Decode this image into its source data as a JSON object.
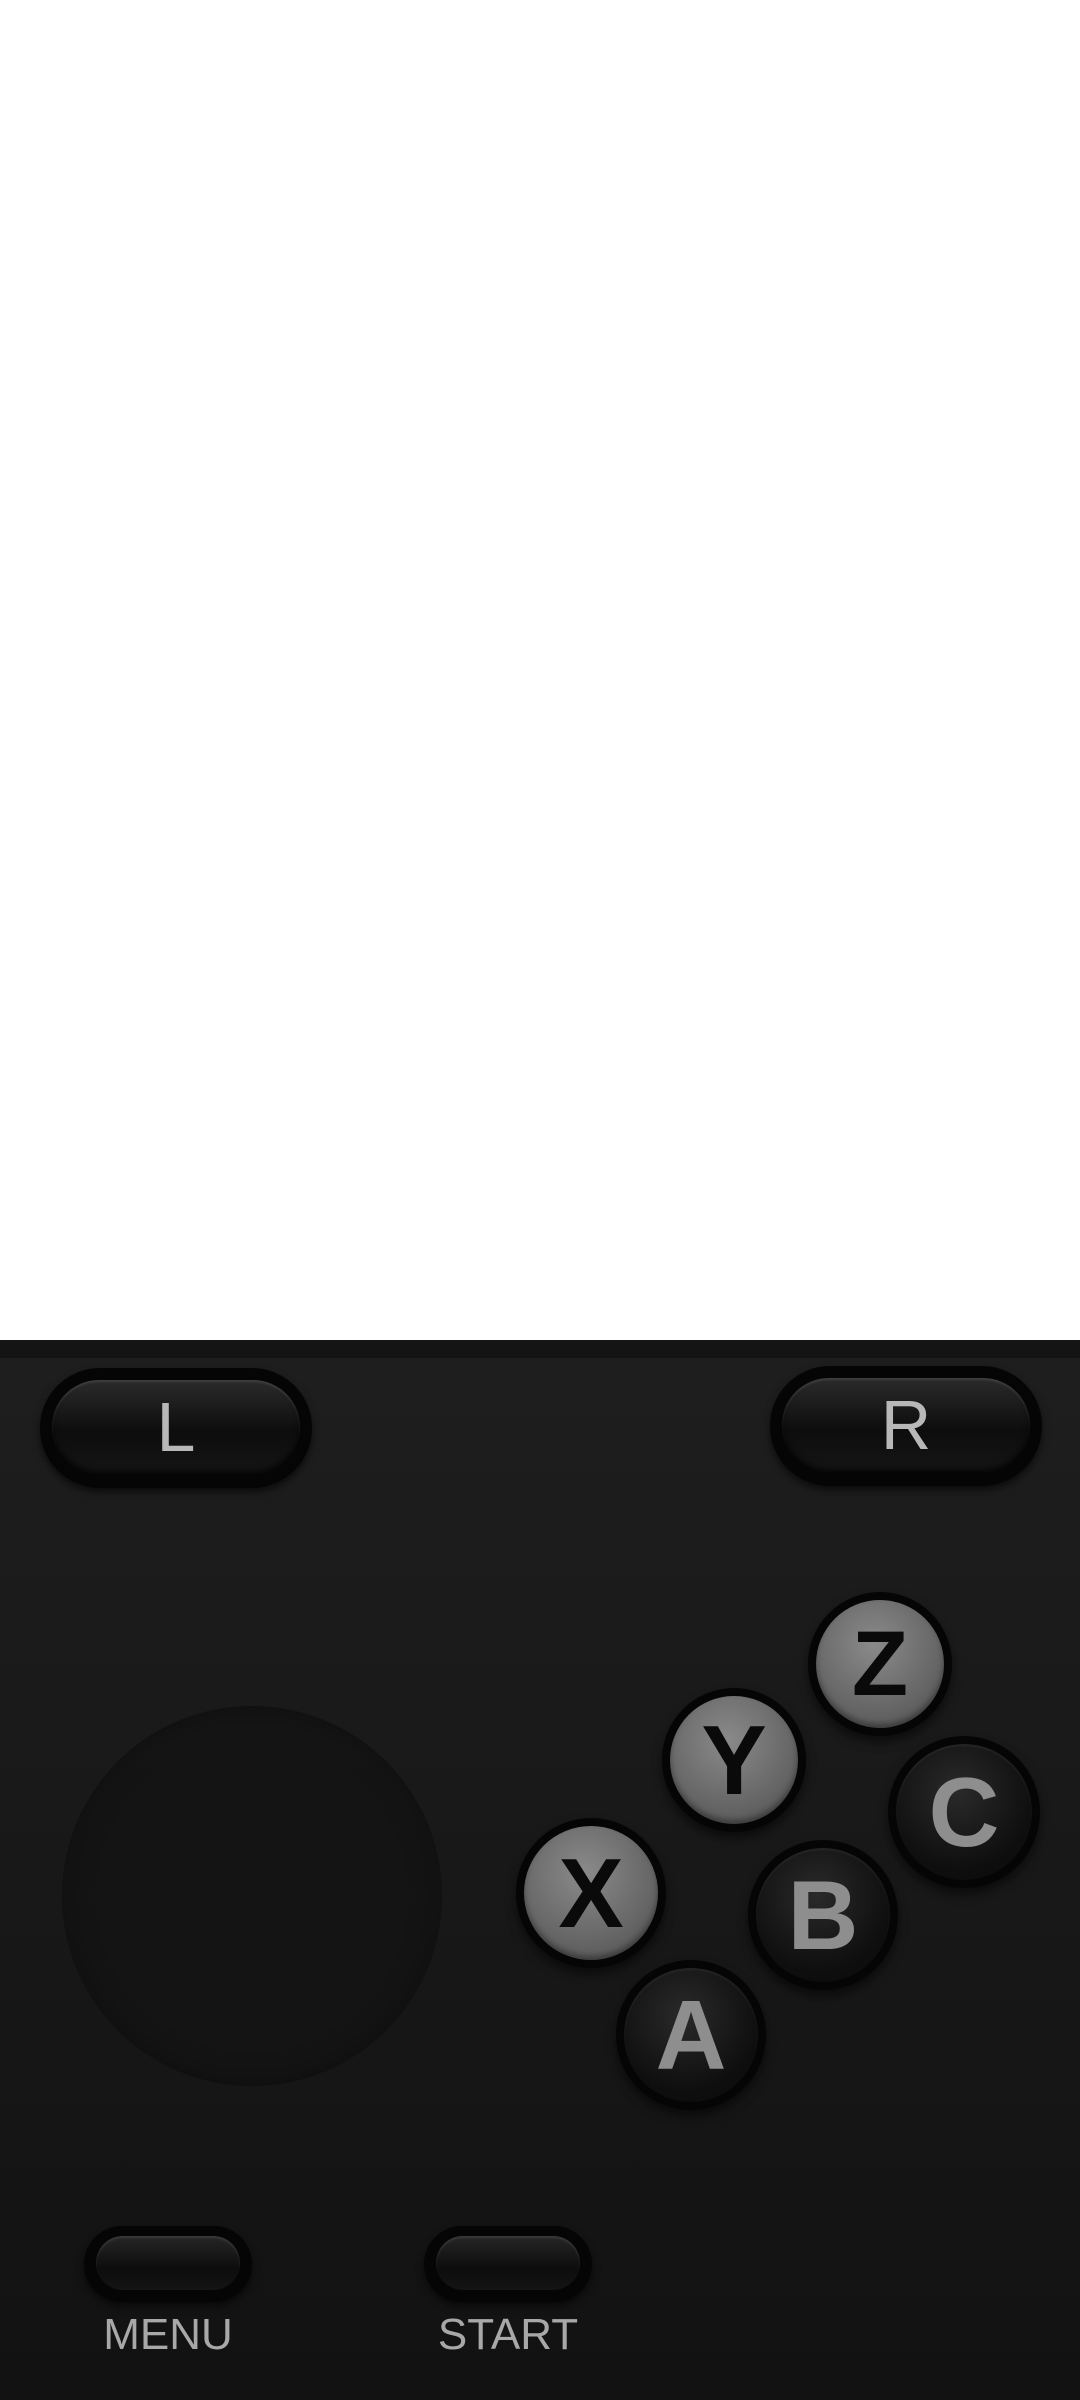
{
  "screen": {
    "background": "#ffffff"
  },
  "controller": {
    "background": "#1a1a1a",
    "shoulder": {
      "left_label": "L",
      "right_label": "R"
    },
    "face_buttons": {
      "z": "Z",
      "y": "Y",
      "c": "C",
      "x": "X",
      "b": "B",
      "a": "A"
    },
    "system": {
      "menu_label": "MENU",
      "start_label": "START"
    }
  }
}
